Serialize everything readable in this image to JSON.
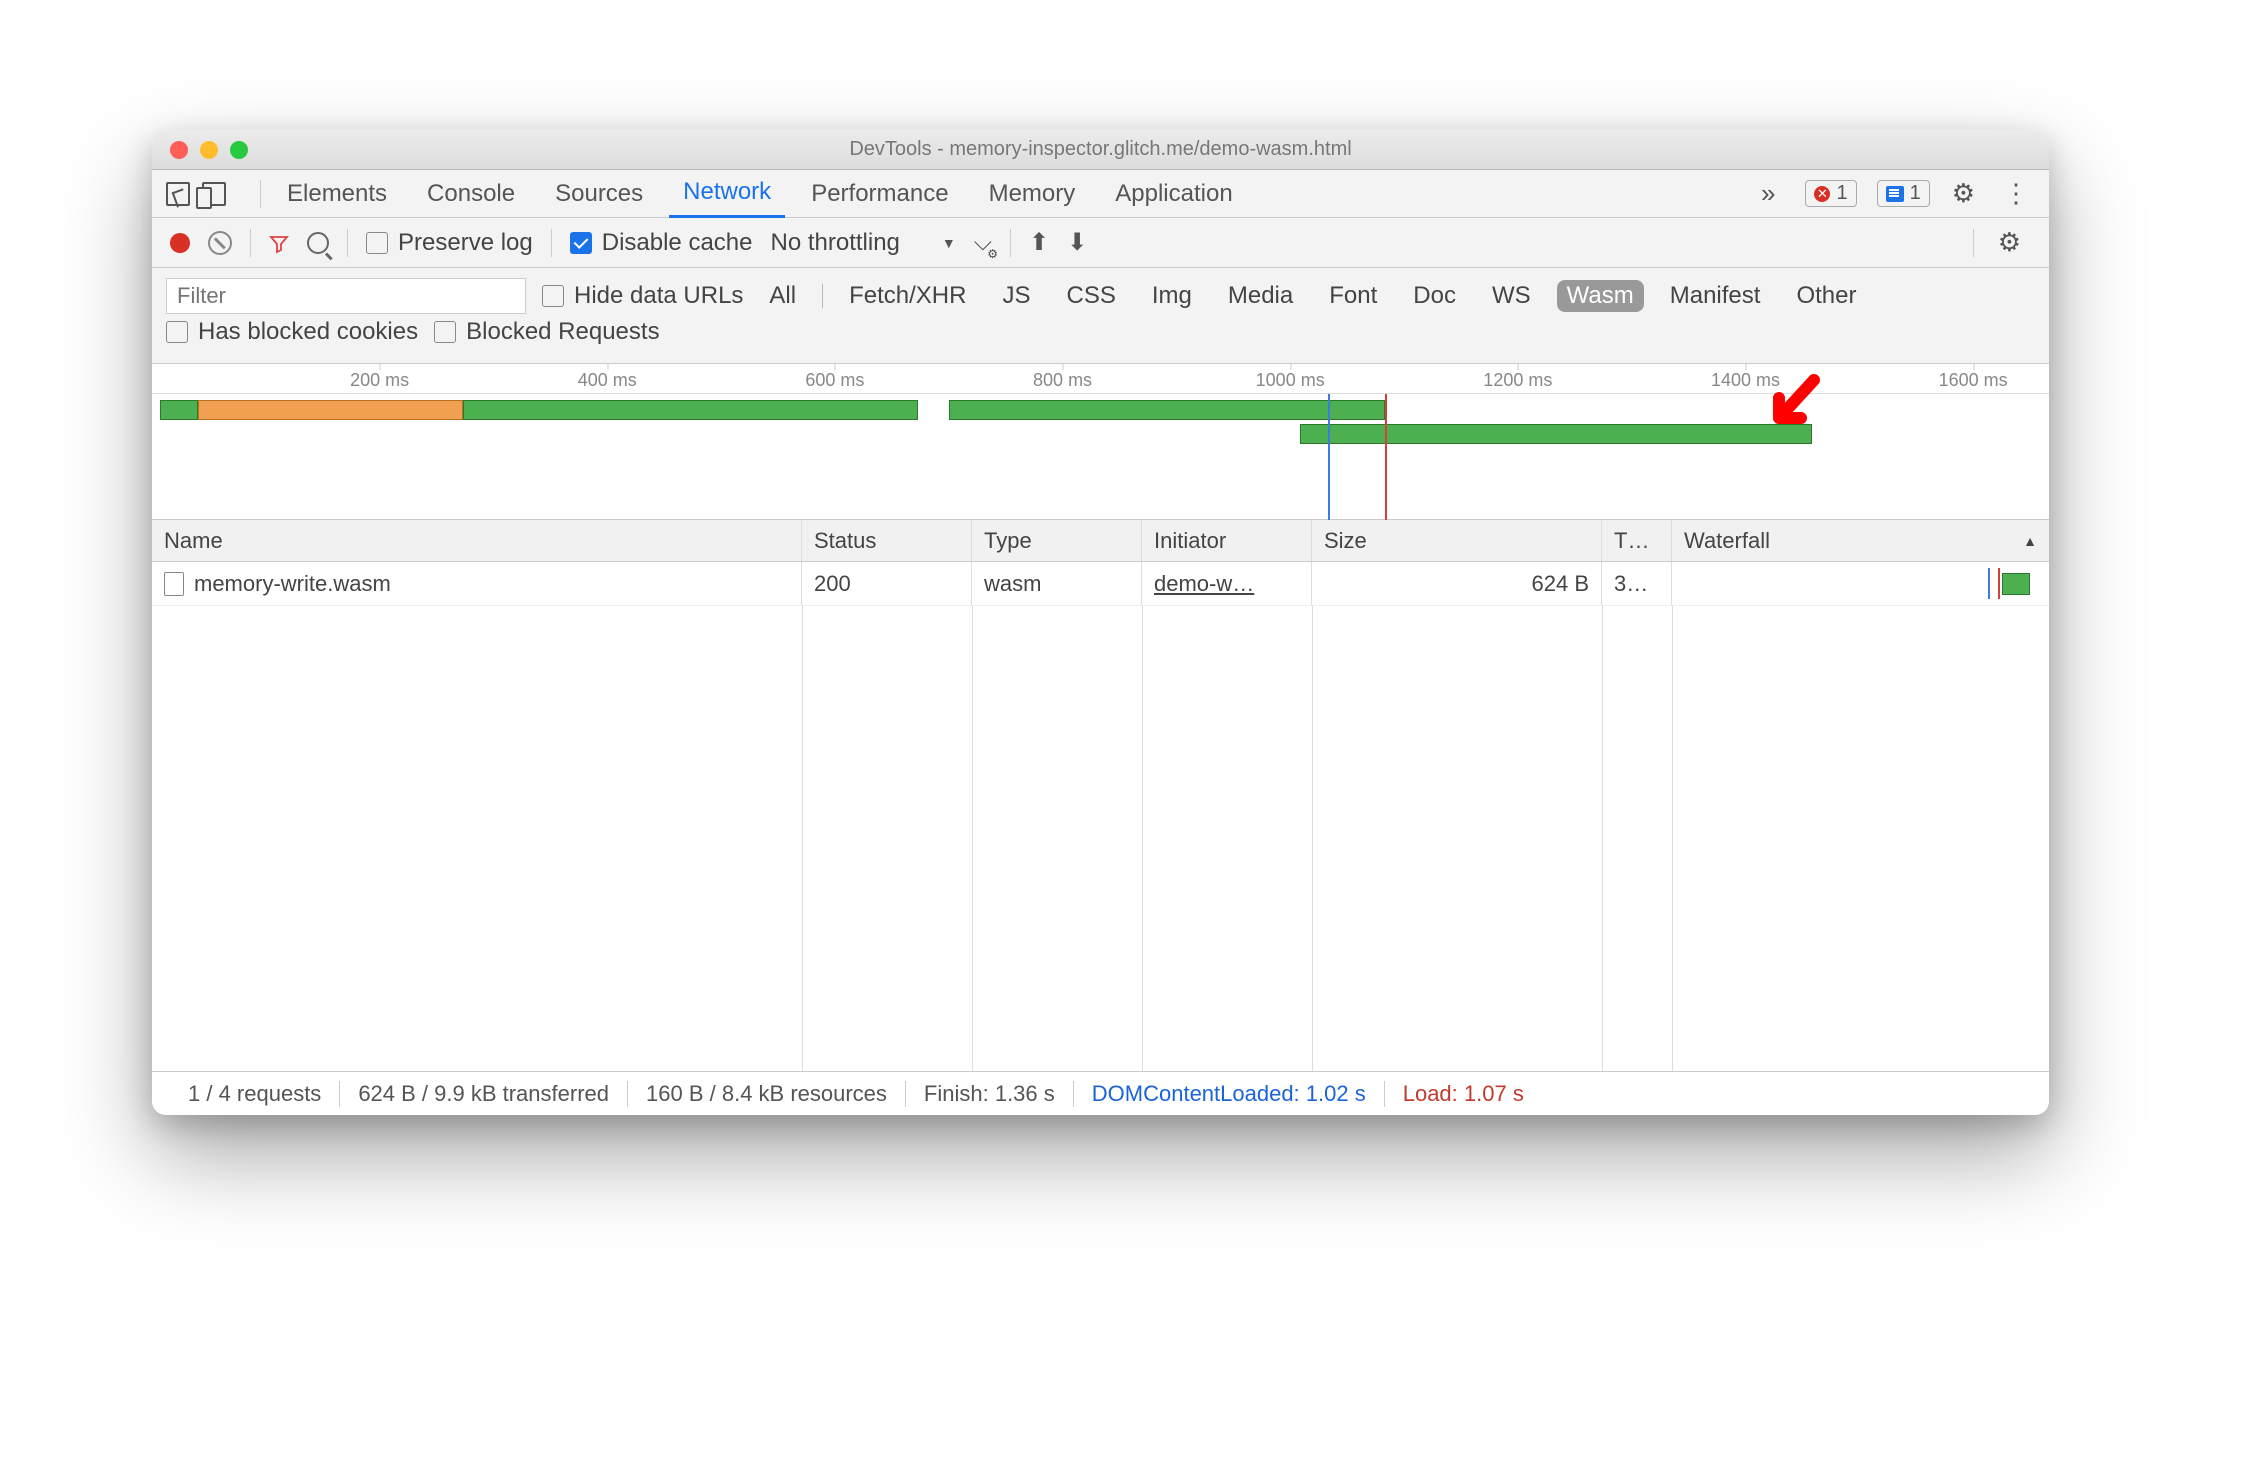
{
  "window": {
    "title": "DevTools - memory-inspector.glitch.me/demo-wasm.html"
  },
  "tabs": {
    "items": [
      "Elements",
      "Console",
      "Sources",
      "Network",
      "Performance",
      "Memory",
      "Application"
    ],
    "active_index": 3,
    "error_badge": "1",
    "message_badge": "1"
  },
  "toolbar": {
    "preserve_log": "Preserve log",
    "disable_cache": "Disable cache",
    "throttling": "No throttling"
  },
  "filterbar": {
    "filter_placeholder": "Filter",
    "hide_data_urls": "Hide data URLs",
    "types": [
      "All",
      "Fetch/XHR",
      "JS",
      "CSS",
      "Img",
      "Media",
      "Font",
      "Doc",
      "WS",
      "Wasm",
      "Manifest",
      "Other"
    ],
    "selected_type_index": 9,
    "has_blocked_cookies": "Has blocked cookies",
    "blocked_requests": "Blocked Requests"
  },
  "timeline": {
    "ticks": [
      "200 ms",
      "400 ms",
      "600 ms",
      "800 ms",
      "1000 ms",
      "1200 ms",
      "1400 ms",
      "1600 ms"
    ]
  },
  "table": {
    "headers": {
      "name": "Name",
      "status": "Status",
      "type": "Type",
      "initiator": "Initiator",
      "size": "Size",
      "t": "T…",
      "waterfall": "Waterfall"
    },
    "rows": [
      {
        "name": "memory-write.wasm",
        "status": "200",
        "type": "wasm",
        "initiator": "demo-w…",
        "size": "624 B",
        "t": "3…"
      }
    ]
  },
  "statusbar": {
    "requests": "1 / 4 requests",
    "transferred": "624 B / 9.9 kB transferred",
    "resources": "160 B / 8.4 kB resources",
    "finish": "Finish: 1.36 s",
    "dcl": "DOMContentLoaded: 1.02 s",
    "load": "Load: 1.07 s"
  }
}
